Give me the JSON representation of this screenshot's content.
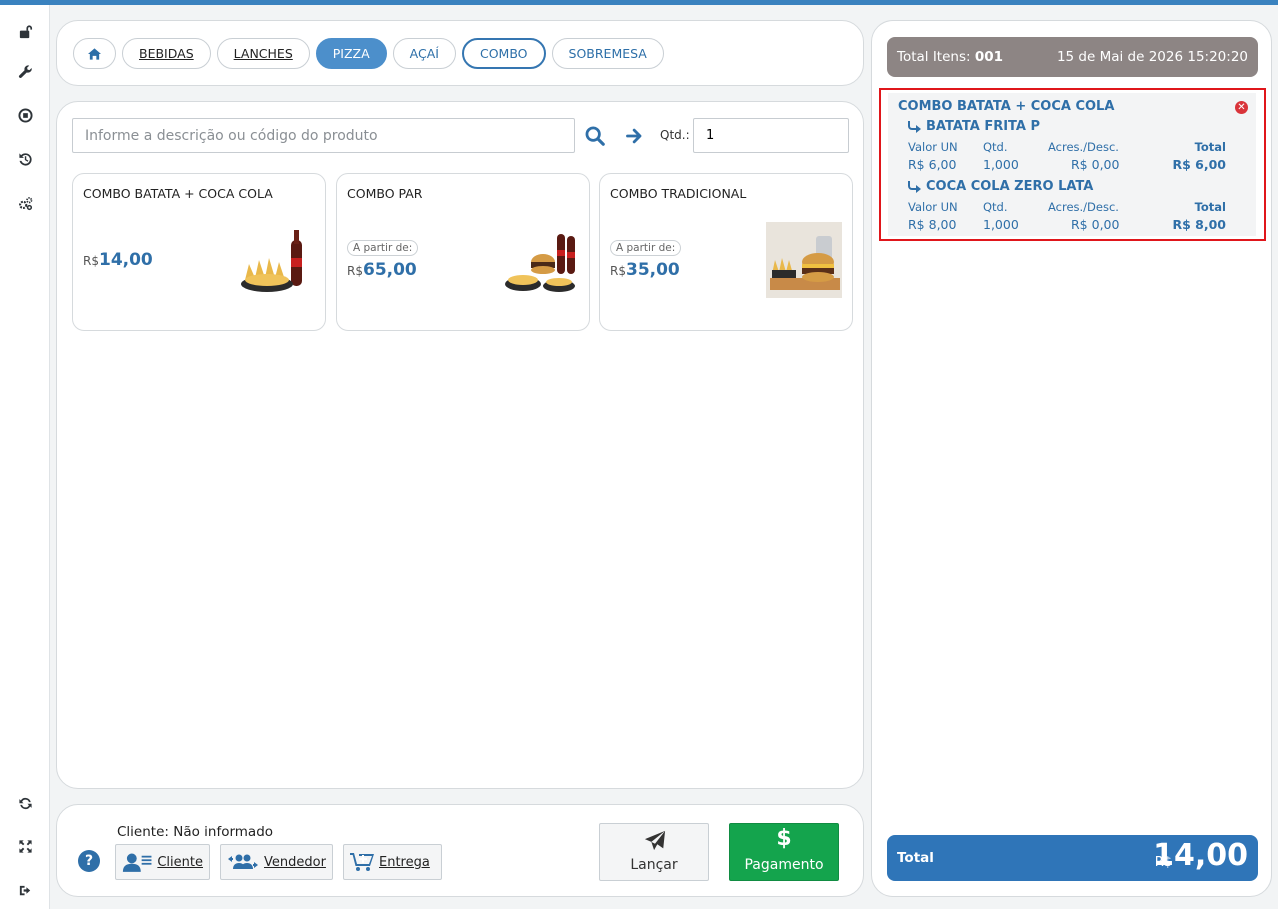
{
  "categories": [
    {
      "label": "",
      "icon": "home-icon",
      "style": "home"
    },
    {
      "label": "BEBIDAS",
      "style": "dark"
    },
    {
      "label": "LANCHES",
      "style": "dark"
    },
    {
      "label": "PIZZA",
      "style": "active"
    },
    {
      "label": "AÇAÍ",
      "style": "plain"
    },
    {
      "label": "COMBO",
      "style": "outlined"
    },
    {
      "label": "SOBREMESA",
      "style": "plain"
    }
  ],
  "search": {
    "placeholder": "Informe a descrição ou código do produto",
    "qty_label": "Qtd.:",
    "qty_value": "1"
  },
  "products": [
    {
      "name": "COMBO BATATA + COCA COLA",
      "from_label": "",
      "currency": "R$",
      "price": "14,00"
    },
    {
      "name": "COMBO PAR",
      "from_label": "A partir de:",
      "currency": "R$",
      "price": "65,00"
    },
    {
      "name": "COMBO TRADICIONAL",
      "from_label": "A partir de:",
      "currency": "R$",
      "price": "35,00"
    }
  ],
  "footer": {
    "cliente_label": "Cliente: Não informado",
    "cliente_btn": "Cliente",
    "vendedor_btn": "Vendedor",
    "entrega_btn": "Entrega",
    "lancar_btn": "Lançar",
    "pagamento_btn": "Pagamento",
    "pagamento_symbol": "$",
    "help_symbol": "?"
  },
  "cart": {
    "items_label": "Total Itens:",
    "items_count": "001",
    "datetime": "15 de Mai de 2026 15:20:20",
    "item": {
      "title": "COMBO BATATA + COCA COLA",
      "subitems": [
        {
          "name": "BATATA FRITA P",
          "valor_un": "R$ 6,00",
          "qtd": "1,000",
          "acres": "R$ 0,00",
          "total": "R$ 6,00"
        },
        {
          "name": "COCA COLA ZERO LATA",
          "valor_un": "R$ 8,00",
          "qtd": "1,000",
          "acres": "R$ 0,00",
          "total": "R$ 8,00"
        }
      ],
      "headers": {
        "valor_un": "Valor UN",
        "qtd": "Qtd.",
        "acres": "Acres./Desc.",
        "total": "Total"
      }
    },
    "total_label": "Total",
    "total_currency": "R$",
    "total_value": "14,00"
  },
  "colors": {
    "accent": "#2f6fa8",
    "active_category": "#4c8fcb",
    "pay_button": "#14a44d",
    "cart_header": "#8d8584",
    "cart_total": "#2f75b8",
    "highlight_border": "#e0161b"
  }
}
